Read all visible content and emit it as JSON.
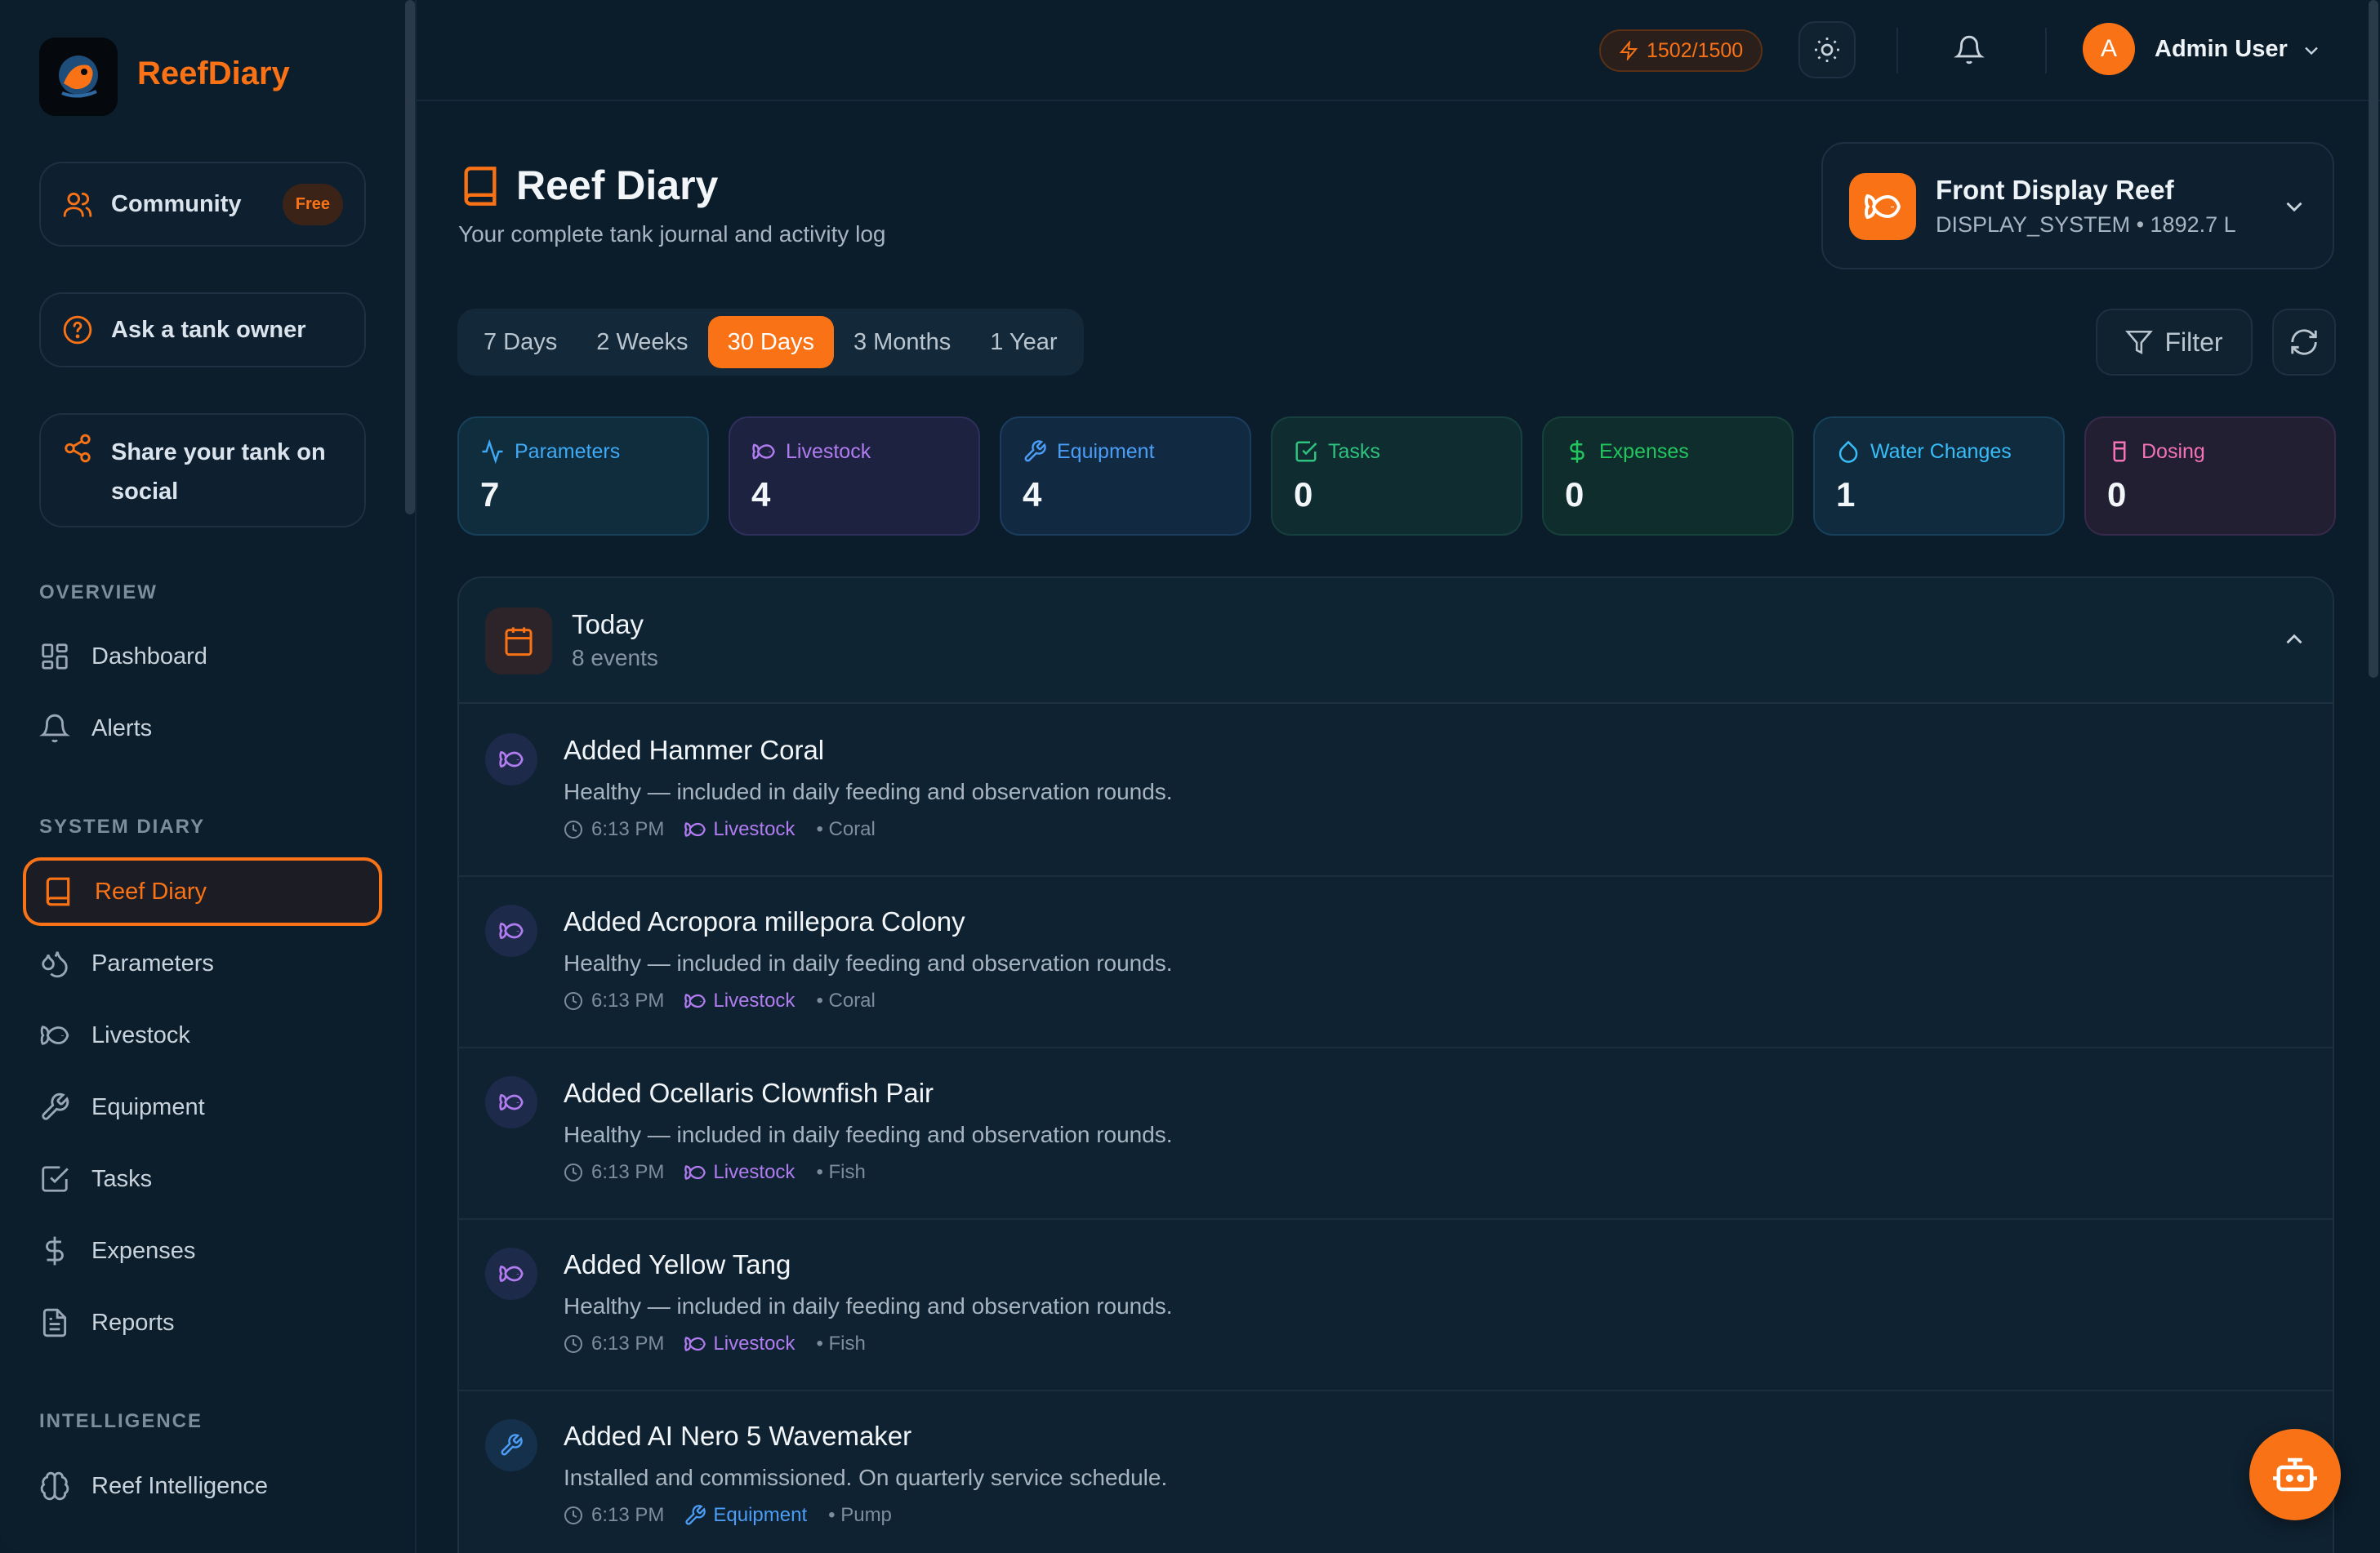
{
  "brand": {
    "name": "ReefDiary"
  },
  "sidebar": {
    "cards": [
      {
        "label": "Community",
        "badge": "Free"
      },
      {
        "label": "Ask a tank owner"
      },
      {
        "label_line1": "Share your tank on",
        "label_line2": "social"
      }
    ],
    "sections": {
      "overview": "OVERVIEW",
      "system_diary": "SYSTEM DIARY",
      "intelligence": "INTELLIGENCE"
    },
    "overview_items": [
      "Dashboard",
      "Alerts"
    ],
    "diary_items": [
      "Reef Diary",
      "Parameters",
      "Livestock",
      "Equipment",
      "Tasks",
      "Expenses",
      "Reports"
    ],
    "intelligence_items": [
      "Reef Intelligence"
    ],
    "active_item": "Reef Diary"
  },
  "topbar": {
    "credits": "1502/1500",
    "user_initial": "A",
    "user_name": "Admin User"
  },
  "header": {
    "title": "Reef Diary",
    "subtitle": "Your complete tank journal and activity log"
  },
  "tank": {
    "name": "Front Display Reef",
    "meta": "DISPLAY_SYSTEM • 1892.7 L"
  },
  "ranges": {
    "options": [
      "7 Days",
      "2 Weeks",
      "30 Days",
      "3 Months",
      "1 Year"
    ],
    "selected": "30 Days"
  },
  "actions": {
    "filter": "Filter"
  },
  "stats": [
    {
      "label": "Parameters",
      "value": "7",
      "color": "#3fa9f5"
    },
    {
      "label": "Livestock",
      "value": "4",
      "color": "#b07cf0"
    },
    {
      "label": "Equipment",
      "value": "4",
      "color": "#4b9df5"
    },
    {
      "label": "Tasks",
      "value": "0",
      "color": "#2ec27e"
    },
    {
      "label": "Expenses",
      "value": "0",
      "color": "#22c55e"
    },
    {
      "label": "Water Changes",
      "value": "1",
      "color": "#38bdf8"
    },
    {
      "label": "Dosing",
      "value": "0",
      "color": "#f472b6"
    }
  ],
  "timeline": {
    "day": "Today",
    "count": "8 events",
    "events": [
      {
        "title": "Added Hammer Coral",
        "desc": "Healthy — included in daily feeding and observation rounds.",
        "time": "6:13 PM",
        "category": "Livestock",
        "sub": "• Coral",
        "icon": "fish-icon"
      },
      {
        "title": "Added Acropora millepora Colony",
        "desc": "Healthy — included in daily feeding and observation rounds.",
        "time": "6:13 PM",
        "category": "Livestock",
        "sub": "• Coral",
        "icon": "fish-icon"
      },
      {
        "title": "Added Ocellaris Clownfish Pair",
        "desc": "Healthy — included in daily feeding and observation rounds.",
        "time": "6:13 PM",
        "category": "Livestock",
        "sub": "• Fish",
        "icon": "fish-icon"
      },
      {
        "title": "Added Yellow Tang",
        "desc": "Healthy — included in daily feeding and observation rounds.",
        "time": "6:13 PM",
        "category": "Livestock",
        "sub": "• Fish",
        "icon": "fish-icon"
      },
      {
        "title": "Added AI Nero 5 Wavemaker",
        "desc": "Installed and commissioned. On quarterly service schedule.",
        "time": "6:13 PM",
        "category": "Equipment",
        "sub": "• Pump",
        "icon": "wrench-icon"
      }
    ]
  },
  "colors": {
    "accent": "#f97316",
    "livestock": "#b07cf0",
    "equipment": "#4b9df5"
  }
}
